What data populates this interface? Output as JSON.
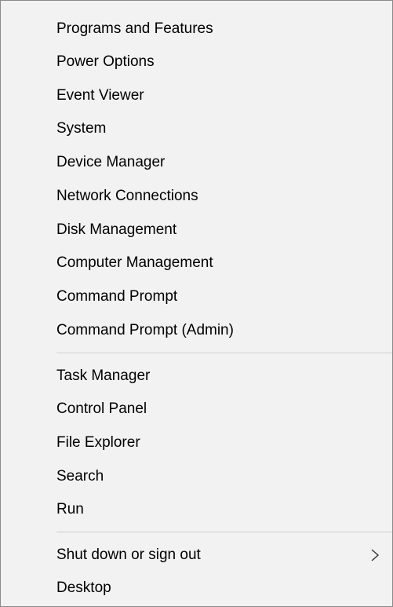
{
  "menu": {
    "group1": [
      "Programs and Features",
      "Power Options",
      "Event Viewer",
      "System",
      "Device Manager",
      "Network Connections",
      "Disk Management",
      "Computer Management",
      "Command Prompt",
      "Command Prompt (Admin)"
    ],
    "group2": [
      "Task Manager",
      "Control Panel",
      "File Explorer",
      "Search",
      "Run"
    ],
    "group3": [
      "Shut down or sign out",
      "Desktop"
    ],
    "submenu_icon": "chevron-right-icon"
  }
}
